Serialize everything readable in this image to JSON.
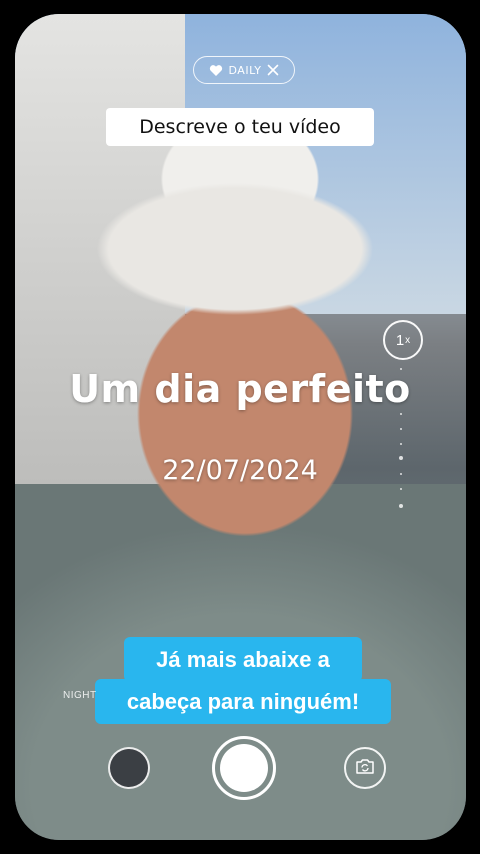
{
  "top_pill": {
    "label": "DAILY",
    "icon_left": "heart-icon",
    "icon_right": "close-icon"
  },
  "prompt": {
    "label": "Descreve o teu vídeo"
  },
  "zoom": {
    "value": "1",
    "suffix": "x"
  },
  "overlay": {
    "title": "Um dia perfeito",
    "date": "22/07/2024"
  },
  "caption": {
    "line1": "Já mais abaixe a",
    "line2": "cabeça para ninguém!",
    "color": "#29b6ee"
  },
  "mode": {
    "label": "NIGHT"
  },
  "controls": {
    "gallery_icon": "gallery-thumbnail",
    "shutter_icon": "shutter-button",
    "flip_icon": "camera-flip-icon"
  }
}
